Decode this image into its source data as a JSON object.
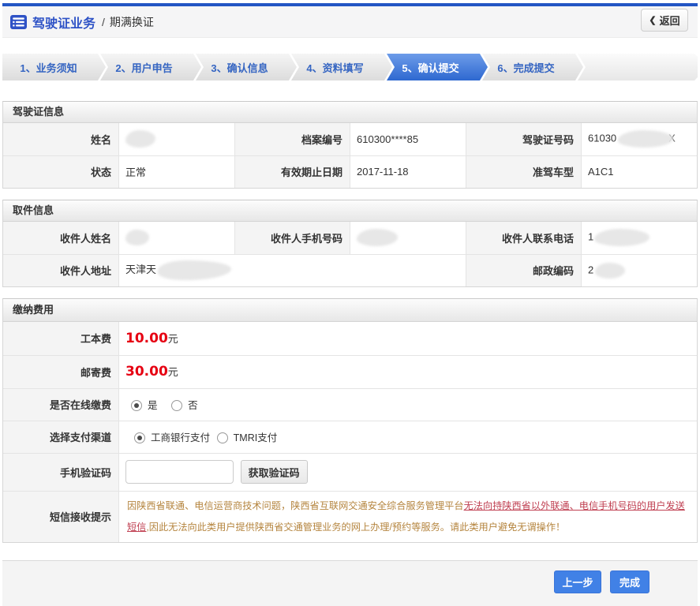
{
  "header": {
    "title": "驾驶证业务",
    "separator": "/",
    "subtitle": "期满换证",
    "back_label": "返回",
    "back_icon": "chevron-left"
  },
  "steps": [
    {
      "label": "1、业务须知",
      "active": false
    },
    {
      "label": "2、用户申告",
      "active": false
    },
    {
      "label": "3、确认信息",
      "active": false
    },
    {
      "label": "4、资料填写",
      "active": false
    },
    {
      "label": "5、确认提交",
      "active": true
    },
    {
      "label": "6、完成提交",
      "active": false
    }
  ],
  "license_section": {
    "title": "驾驶证信息",
    "name": {
      "label": "姓名",
      "value_redacted": true
    },
    "file_no": {
      "label": "档案编号",
      "value": "610300****85"
    },
    "license_no": {
      "label": "驾驶证号码",
      "prefix": "61030",
      "middle_redacted": true,
      "suffix": "X"
    },
    "status": {
      "label": "状态",
      "value": "正常"
    },
    "expiry": {
      "label": "有效期止日期",
      "value": "2017-11-18"
    },
    "vehicle_class": {
      "label": "准驾车型",
      "value": "A1C1"
    }
  },
  "delivery_section": {
    "title": "取件信息",
    "recipient_name": {
      "label": "收件人姓名",
      "value_redacted": true
    },
    "recipient_mobile": {
      "label": "收件人手机号码",
      "value_redacted": true
    },
    "recipient_phone": {
      "label": "收件人联系电话",
      "prefix": "1",
      "rest_redacted": true
    },
    "recipient_address": {
      "label": "收件人地址",
      "prefix": "天津天",
      "rest_redacted": true
    },
    "postal_code": {
      "label": "邮政编码",
      "prefix": "2",
      "rest_redacted": true
    }
  },
  "payment_section": {
    "title": "缴纳费用",
    "work_fee": {
      "label": "工本费",
      "amount": "10.00",
      "unit": "元"
    },
    "mail_fee": {
      "label": "邮寄费",
      "amount": "30.00",
      "unit": "元"
    },
    "online_payment": {
      "label": "是否在线缴费",
      "option_yes": {
        "label": "是",
        "selected": true
      },
      "option_no": {
        "label": "否",
        "selected": false
      }
    },
    "payment_channel": {
      "label": "选择支付渠道",
      "option_icbc": {
        "label": "工商银行支付",
        "selected": true
      },
      "option_tmri": {
        "label": "TMRI支付",
        "selected": false
      }
    },
    "sms_code": {
      "label": "手机验证码",
      "input_value": "",
      "button_label": "获取验证码"
    },
    "sms_notice": {
      "label": "短信接收提示",
      "text_before": "因陕西省联通、电信运营商技术问题，陕西省互联网交通安全综合服务管理平台",
      "text_emphasis": "无法向持陕西省以外联通、电信手机号码的用户发送短信",
      "text_after": ",因此无法向此类用户提供陕西省交通管理业务的网上办理/预约等服务。请此类用户避免无谓操作！"
    }
  },
  "footer": {
    "prev_label": "上一步",
    "finish_label": "完成"
  },
  "colors": {
    "accent_blue": "#2355c4",
    "active_step_blue": "#2e68d0",
    "button_blue": "#4181e6",
    "fee_red": "#e60012",
    "notice_brown": "#b5853f",
    "notice_red": "#c04052"
  }
}
